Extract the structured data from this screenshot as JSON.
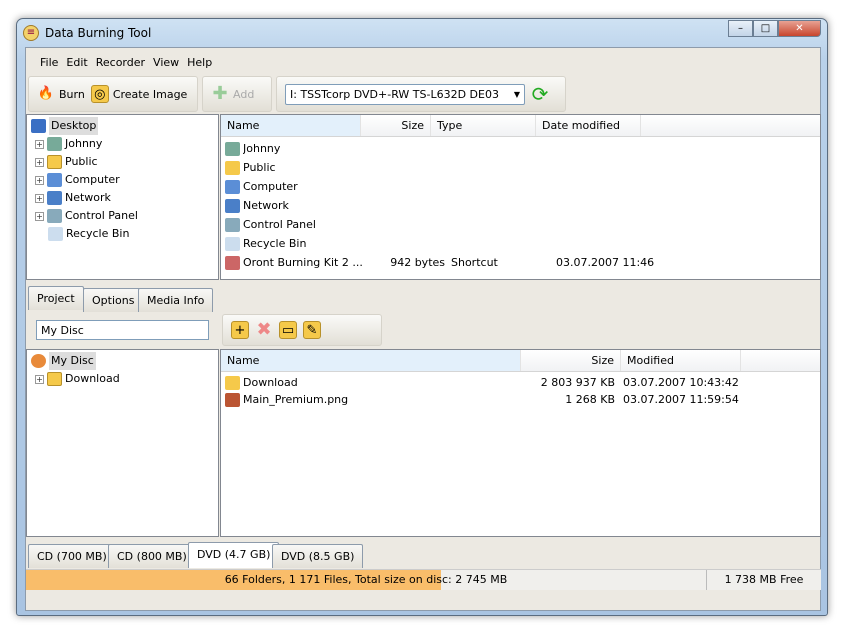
{
  "window": {
    "title": "Data Burning Tool",
    "controls": {
      "minimize": "–",
      "maximize": "□",
      "close": "✕"
    }
  },
  "menu": [
    "File",
    "Edit",
    "Recorder",
    "View",
    "Help"
  ],
  "toolbar": {
    "burn": "Burn",
    "create_image": "Create Image",
    "add": "Add",
    "drive": "I: TSSTcorp DVD+-RW TS-L632D DE03"
  },
  "explorer_tree": {
    "root": "Desktop",
    "items": [
      "Johnny",
      "Public",
      "Computer",
      "Network",
      "Control Panel",
      "Recycle Bin"
    ]
  },
  "explorer_list": {
    "columns": [
      "Name",
      "Size",
      "Type",
      "Date modified"
    ],
    "rows": [
      {
        "name": "Johnny",
        "size": "",
        "type": "",
        "date": ""
      },
      {
        "name": "Public",
        "size": "",
        "type": "",
        "date": ""
      },
      {
        "name": "Computer",
        "size": "",
        "type": "",
        "date": ""
      },
      {
        "name": "Network",
        "size": "",
        "type": "",
        "date": ""
      },
      {
        "name": "Control Panel",
        "size": "",
        "type": "",
        "date": ""
      },
      {
        "name": "Recycle Bin",
        "size": "",
        "type": "",
        "date": ""
      },
      {
        "name": "Oront Burning Kit 2 ...",
        "size": "942 bytes",
        "type": "Shortcut",
        "date": "03.07.2007 11:46"
      }
    ]
  },
  "project_tabs": [
    "Project",
    "Options",
    "Media Info"
  ],
  "disc_name": "My Disc",
  "project_tree": {
    "root": "My Disc",
    "items": [
      "Download"
    ]
  },
  "project_list": {
    "columns": [
      "Name",
      "Size",
      "Modified"
    ],
    "rows": [
      {
        "name": "Download",
        "size": "2 803 937 KB",
        "modified": "03.07.2007 10:43:42"
      },
      {
        "name": "Main_Premium.png",
        "size": "1 268 KB",
        "modified": "03.07.2007 11:59:54"
      }
    ]
  },
  "disc_tabs": [
    "CD (700 MB)",
    "CD (800 MB)",
    "DVD (4.7 GB)",
    "DVD (8.5 GB)"
  ],
  "status": {
    "summary": "66 Folders, 1 171 Files, Total size on disc:",
    "size": "2 745 MB",
    "free": "1 738 MB Free",
    "fill_fraction": 0.61
  }
}
